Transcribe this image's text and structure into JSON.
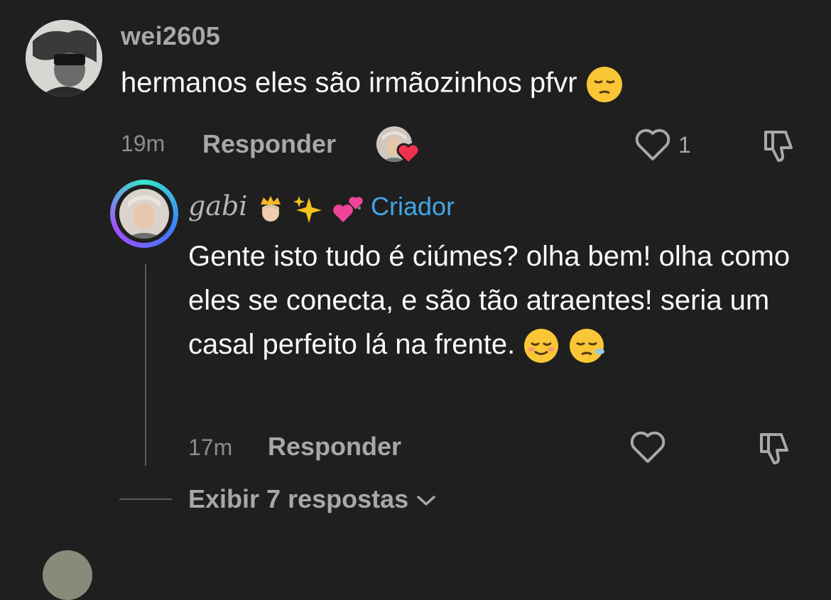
{
  "comment": {
    "username": "wei2605",
    "text": "hermanos eles são irmãozinhos pfvr",
    "time": "19m",
    "reply_label": "Responder",
    "like_count": "1"
  },
  "reply": {
    "username": "gabi",
    "separator": "·",
    "creator_label": "Criador",
    "text": "Gente isto tudo é ciúmes? olha bem! olha como eles se conecta, e são tão atraentes! seria um casal perfeito lá na frente.",
    "time": "17m",
    "reply_label": "Responder"
  },
  "view_replies": {
    "label": "Exibir 7 respostas"
  },
  "colors": {
    "background": "#1f1f1f",
    "creator": "#41a6e6",
    "muted": "#a8a8a8"
  }
}
